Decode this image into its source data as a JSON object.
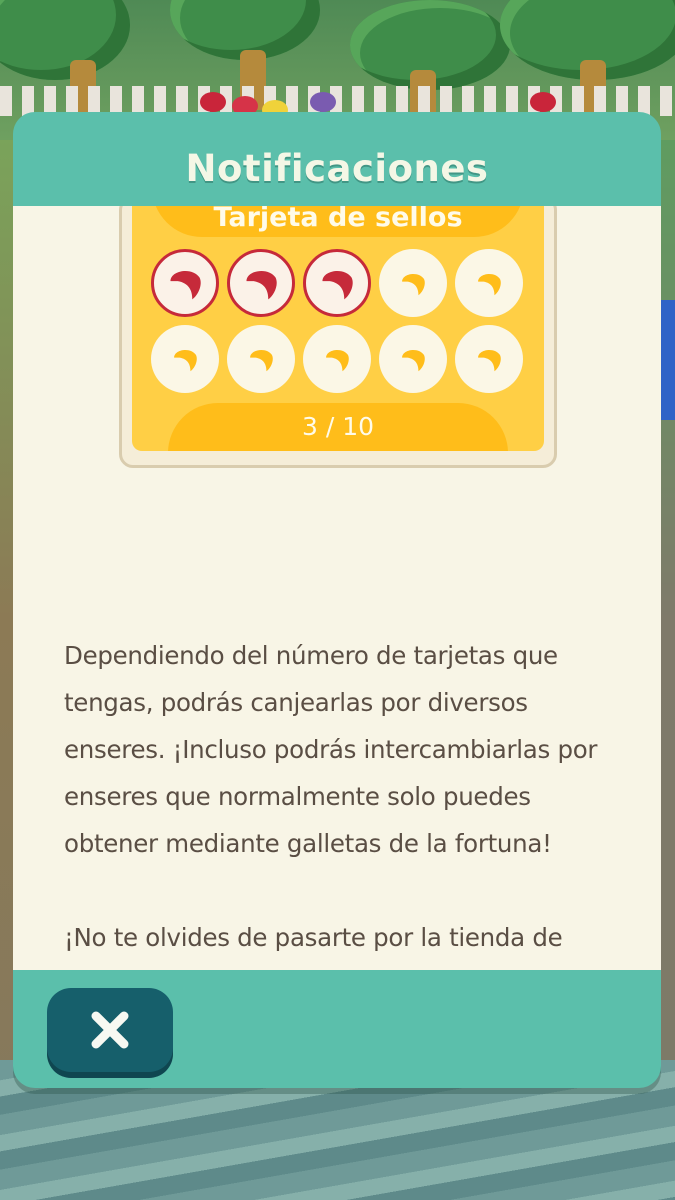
{
  "dialog": {
    "title": "Notificaciones",
    "stamp_card": {
      "title": "Tarjeta de sellos",
      "progress_text": "3 / 10",
      "stamps_collected": 3,
      "stamps_total": 10
    },
    "paragraphs": [
      "Dependiendo del número de tarjetas que tengas, podrás canjearlas por diversos enseres. ¡Incluso podrás intercambiarlas por enseres que normalmente solo puedes obtener mediante galletas de la fortuna!",
      "¡No te olvides de pasarte por la tienda de galletas de la fortuna para intercambiar tarjetas de sellos!"
    ],
    "close_icon": "close-x-icon"
  },
  "colors": {
    "dialog_teal": "#5bbfab",
    "body_cream": "#f8f5e6",
    "card_yellow": "#ffcf45",
    "stamp_red": "#c62a3a",
    "stamp_empty_mark": "#ffbd1a",
    "close_button": "#165f6b"
  }
}
